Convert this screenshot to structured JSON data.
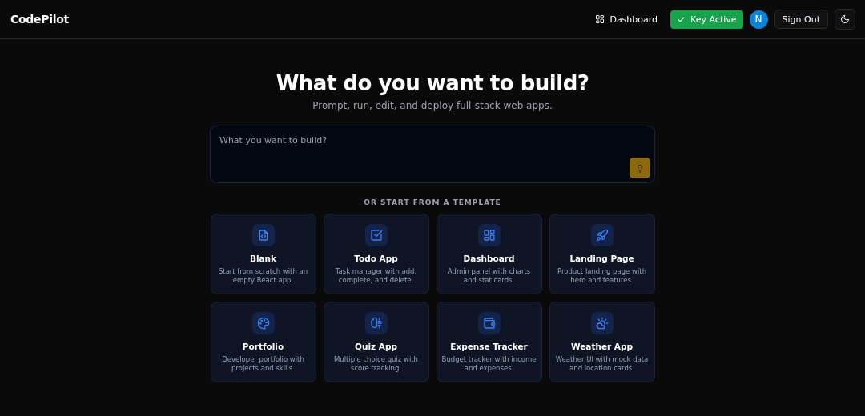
{
  "header": {
    "logo": "CodePilot",
    "nav": [
      {
        "kind": "link",
        "label": "Dashboard"
      },
      {
        "kind": "key",
        "label": "Key Active"
      },
      {
        "kind": "avatar",
        "label": "N"
      },
      {
        "kind": "outline",
        "label": "Sign Out"
      },
      {
        "kind": "theme"
      }
    ]
  },
  "hero": {
    "title": "What do you want to build?",
    "subtitle": "Prompt, run, edit, and deploy full-stack web apps."
  },
  "prompt": {
    "placeholder": "What you want to build?"
  },
  "templates_heading": "OR START FROM A TEMPLATE",
  "templates": [
    {
      "kind": "file-code",
      "title": "Blank",
      "description": "Start from scratch with an empty React app."
    },
    {
      "kind": "check",
      "title": "Todo App",
      "description": "Task manager with add, complete, and delete."
    },
    {
      "kind": "grid",
      "title": "Dashboard",
      "description": "Admin panel with charts and stat cards."
    },
    {
      "kind": "rocket",
      "title": "Landing Page",
      "description": "Product landing page with hero and features."
    },
    {
      "kind": "palette",
      "title": "Portfolio",
      "description": "Developer portfolio with projects and skills."
    },
    {
      "kind": "brain",
      "title": "Quiz App",
      "description": "Multiple choice quiz with score tracking."
    },
    {
      "kind": "wallet",
      "title": "Expense Tracker",
      "description": "Budget tracker with income and expenses."
    },
    {
      "kind": "weather",
      "title": "Weather App",
      "description": "Weather UI with mock data and location cards."
    }
  ]
}
